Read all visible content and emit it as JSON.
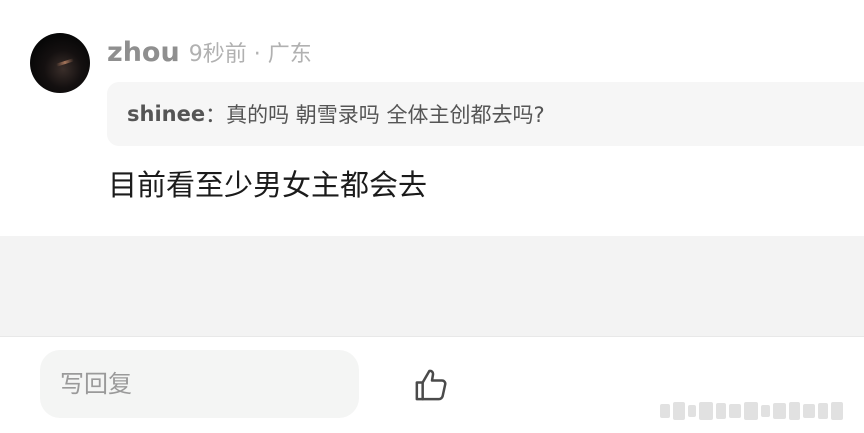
{
  "comment": {
    "username": "zhou",
    "time_location": "9秒前 · 广东",
    "quote": {
      "author": "shinee",
      "separator": "：",
      "text": "真的吗 朝雪录吗 全体主创都去吗?"
    },
    "body": "目前看至少男女主都会去"
  },
  "footer": {
    "reply_placeholder": "写回复"
  },
  "icons": {
    "like": "thumbs-up-icon"
  },
  "colors": {
    "username": "#8f8f8f",
    "meta": "#b1b1b1",
    "quote_bg": "#f6f6f6",
    "body_text": "#1b1b1b",
    "separator_band": "#f3f3f3",
    "input_bg": "#f4f5f4"
  }
}
